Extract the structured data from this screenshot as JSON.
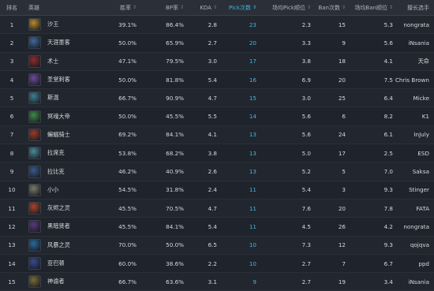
{
  "headers": {
    "rank": "排名",
    "hero": "英雄",
    "win": "胜率",
    "bp": "BP率",
    "kda": "KDA",
    "pick": "Pick次数",
    "pick_pos": "场均Pick顺位",
    "ban": "Ban次数",
    "ban_pos": "场均Ban顺位",
    "player": "擅长选手"
  },
  "rows": [
    {
      "rank": "1",
      "hero": "沙王",
      "win": "39.1%",
      "bp": "86.4%",
      "kda": "2.8",
      "pick": "23",
      "pick_pos": "2.3",
      "ban": "15",
      "ban_pos": "5.3",
      "player": "nongrata",
      "color": "#b8892b"
    },
    {
      "rank": "2",
      "hero": "天涯墨客",
      "win": "50.0%",
      "bp": "65.9%",
      "kda": "2.7",
      "pick": "20",
      "pick_pos": "3.3",
      "ban": "9",
      "ban_pos": "5.6",
      "player": "iNsania",
      "color": "#3f6a9a"
    },
    {
      "rank": "3",
      "hero": "术士",
      "win": "47.1%",
      "bp": "79.5%",
      "kda": "3.0",
      "pick": "17",
      "pick_pos": "3.8",
      "ban": "18",
      "ban_pos": "4.1",
      "player": "天命",
      "color": "#8c2c2c"
    },
    {
      "rank": "4",
      "hero": "圣堂刺客",
      "win": "50.0%",
      "bp": "81.8%",
      "kda": "5.4",
      "pick": "16",
      "pick_pos": "6.9",
      "ban": "20",
      "ban_pos": "7.5",
      "player": "Chris Brown",
      "color": "#6a4a9a"
    },
    {
      "rank": "5",
      "hero": "斯温",
      "win": "66.7%",
      "bp": "90.9%",
      "kda": "4.7",
      "pick": "15",
      "pick_pos": "3.0",
      "ban": "25",
      "ban_pos": "6.4",
      "player": "Micke",
      "color": "#3f7f8f"
    },
    {
      "rank": "6",
      "hero": "冥魂大帝",
      "win": "50.0%",
      "bp": "45.5%",
      "kda": "5.5",
      "pick": "14",
      "pick_pos": "5.6",
      "ban": "6",
      "ban_pos": "8.2",
      "player": "K1",
      "color": "#3f8a4a"
    },
    {
      "rank": "7",
      "hero": "蝙蝠骑士",
      "win": "69.2%",
      "bp": "84.1%",
      "kda": "4.1",
      "pick": "13",
      "pick_pos": "5.6",
      "ban": "24",
      "ban_pos": "6.1",
      "player": "InJuly",
      "color": "#9a3a2a"
    },
    {
      "rank": "8",
      "hero": "拉席克",
      "win": "53.8%",
      "bp": "68.2%",
      "kda": "3.8",
      "pick": "13",
      "pick_pos": "5.0",
      "ban": "17",
      "ban_pos": "2.5",
      "player": "ESD",
      "color": "#4a8a9a"
    },
    {
      "rank": "9",
      "hero": "拉比克",
      "win": "46.2%",
      "bp": "40.9%",
      "kda": "2.6",
      "pick": "13",
      "pick_pos": "5.2",
      "ban": "5",
      "ban_pos": "7.0",
      "player": "Saksa",
      "color": "#3a5a8a"
    },
    {
      "rank": "10",
      "hero": "小小",
      "win": "54.5%",
      "bp": "31.8%",
      "kda": "2.4",
      "pick": "11",
      "pick_pos": "5.4",
      "ban": "3",
      "ban_pos": "9.3",
      "player": "Stinger",
      "color": "#7a7a6a"
    },
    {
      "rank": "11",
      "hero": "灰烬之灵",
      "win": "45.5%",
      "bp": "70.5%",
      "kda": "4.7",
      "pick": "11",
      "pick_pos": "7.6",
      "ban": "20",
      "ban_pos": "7.8",
      "player": "FATA",
      "color": "#a8442a"
    },
    {
      "rank": "12",
      "hero": "黑暗贤者",
      "win": "45.5%",
      "bp": "84.1%",
      "kda": "5.4",
      "pick": "11",
      "pick_pos": "4.5",
      "ban": "26",
      "ban_pos": "4.2",
      "player": "nongrata",
      "color": "#5a3a7a"
    },
    {
      "rank": "13",
      "hero": "风暴之灵",
      "win": "70.0%",
      "bp": "50.0%",
      "kda": "6.5",
      "pick": "10",
      "pick_pos": "7.3",
      "ban": "12",
      "ban_pos": "9.3",
      "player": "qojqva",
      "color": "#2a6a9a"
    },
    {
      "rank": "14",
      "hero": "亚巴顿",
      "win": "60.0%",
      "bp": "38.6%",
      "kda": "2.2",
      "pick": "10",
      "pick_pos": "2.7",
      "ban": "7",
      "ban_pos": "6.7",
      "player": "ppd",
      "color": "#3a4a8a"
    },
    {
      "rank": "15",
      "hero": "神谕者",
      "win": "66.7%",
      "bp": "63.6%",
      "kda": "3.1",
      "pick": "9",
      "pick_pos": "2.7",
      "ban": "19",
      "ban_pos": "3.4",
      "player": "iNsania",
      "color": "#7a6a3a"
    }
  ]
}
